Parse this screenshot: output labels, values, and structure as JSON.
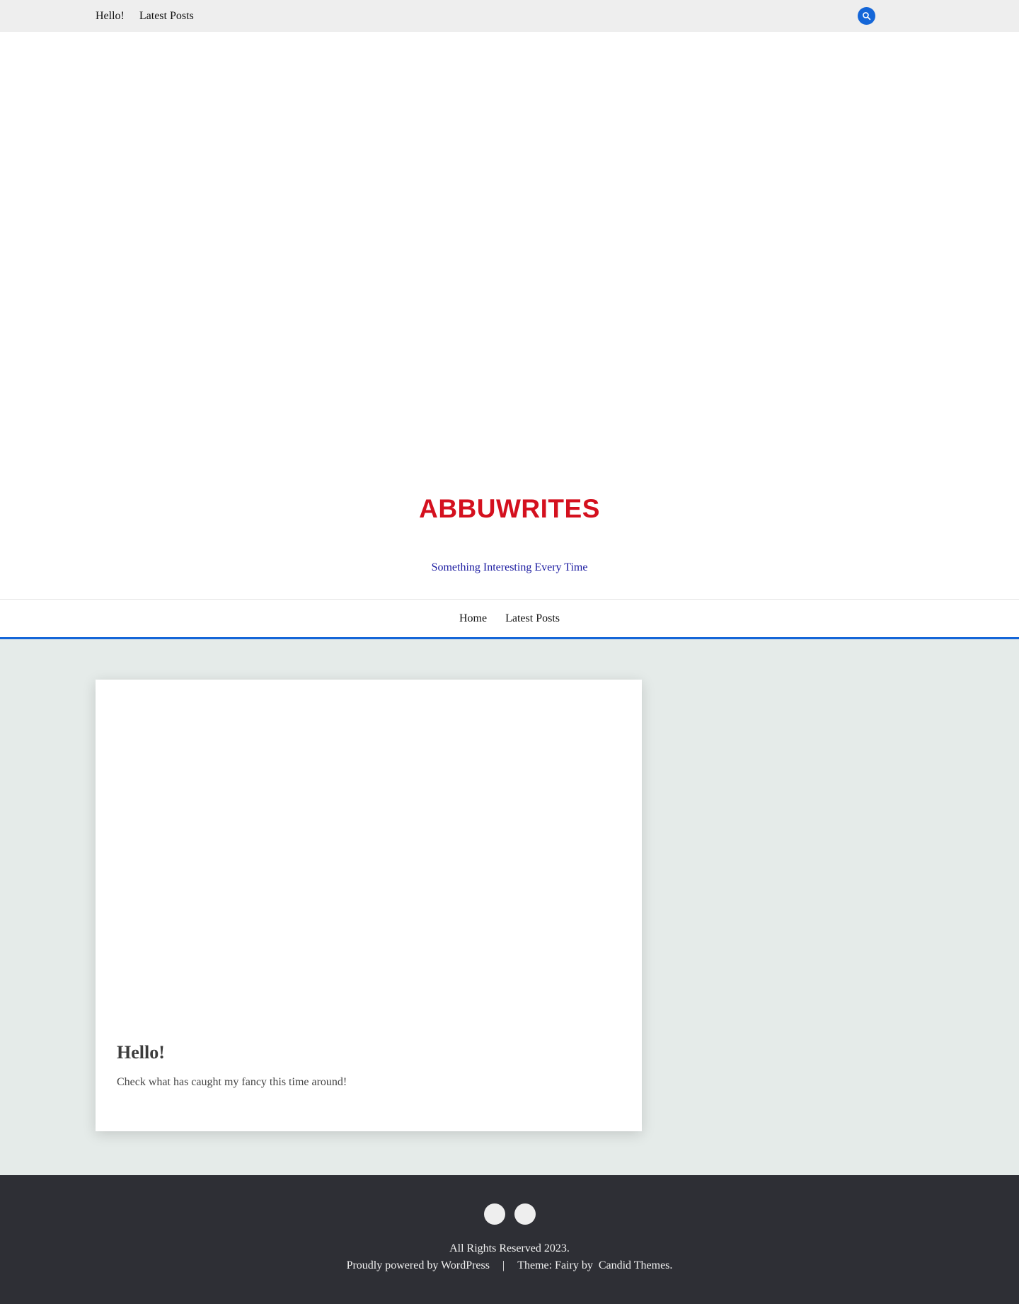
{
  "topbar": {
    "nav": [
      "Hello!",
      "Latest Posts"
    ]
  },
  "header": {
    "site_title": "ABBUWRITES",
    "tagline": "Something Interesting Every Time"
  },
  "main_nav": {
    "items": [
      "Home",
      "Latest Posts"
    ]
  },
  "post": {
    "title": "Hello!",
    "excerpt": "Check what has caught my fancy this time around!"
  },
  "footer": {
    "copyright": "All Rights Reserved 2023.",
    "powered_by": "Proudly powered by WordPress",
    "separator": "|",
    "theme_prefix": "Theme: Fairy by",
    "theme_author": "Candid Themes."
  },
  "colors": {
    "accent": "#1466d8",
    "title": "#d4101e",
    "tagline": "#1a1aa0",
    "footer_bg": "#2e2f35",
    "content_bg": "#e5ebe9"
  }
}
